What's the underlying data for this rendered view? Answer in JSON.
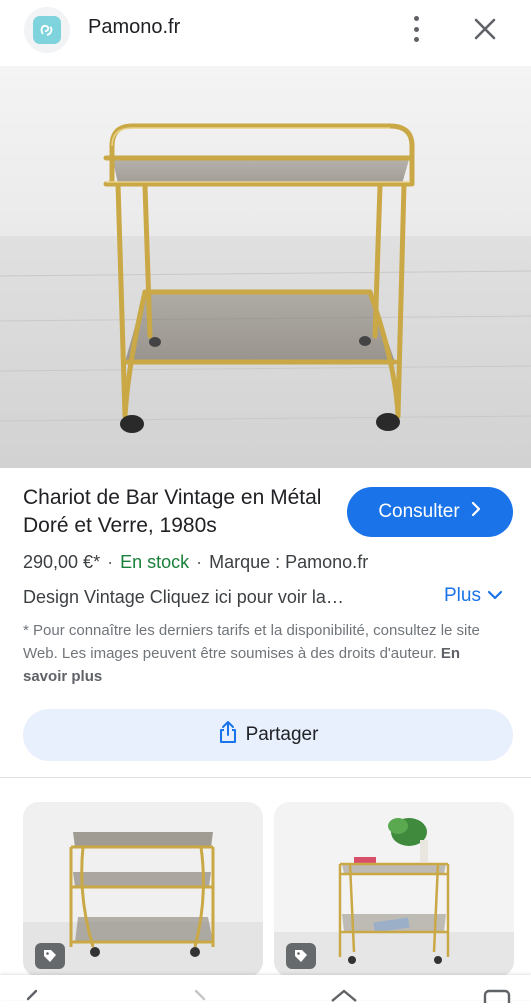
{
  "topbar": {
    "site_name": "Pamono.fr"
  },
  "product": {
    "title": "Chariot de Bar Vintage en Métal Doré et Verre, 1980s",
    "visit_label": "Consulter",
    "price": "290,00 €*",
    "stock": "En stock",
    "brand": "Marque : Pamono.fr",
    "description": "Design Vintage Cliquez ici pour voir la…",
    "more_label": "Plus",
    "disclaimer": "* Pour connaître les derniers tarifs et la disponibilité, consultez le site Web. Les images peuvent être soumises à des droits d'auteur.",
    "learn_more": "En savoir plus",
    "share_label": "Partager"
  },
  "related": [
    {
      "kind": "gold bar cart with smoked glass shelves"
    },
    {
      "kind": "gold bar cart with plant and magazines"
    }
  ],
  "colors": {
    "primary": "#1a73e8",
    "stock_green": "#188038",
    "share_bg": "#e8f0fe",
    "text": "#202124"
  },
  "icons": [
    "pamono-favicon-icon",
    "more-vert-icon",
    "close-icon",
    "chevron-right-icon",
    "chevron-down-icon",
    "share-icon",
    "tag-icon",
    "back-icon",
    "forward-icon",
    "home-icon",
    "tabs-icon"
  ]
}
